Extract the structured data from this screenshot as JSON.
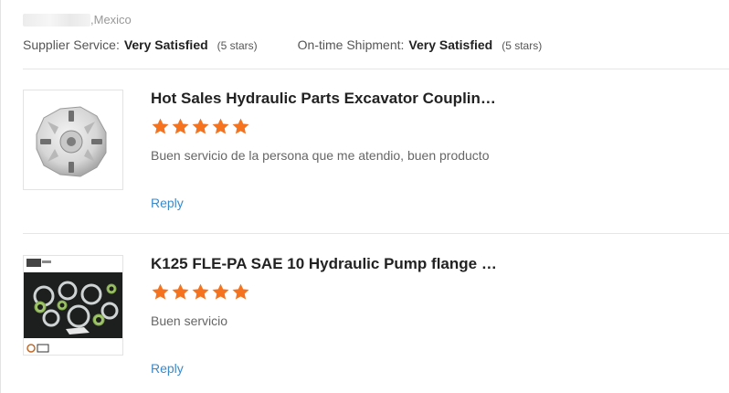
{
  "header": {
    "location": ",Mexico",
    "supplier_label": "Supplier Service:",
    "supplier_value": "Very Satisfied",
    "supplier_stars": "(5 stars)",
    "shipment_label": "On-time Shipment:",
    "shipment_value": "Very Satisfied",
    "shipment_stars": "(5 stars)"
  },
  "reviews": [
    {
      "title": "Hot Sales Hydraulic Parts Excavator Coupling ...",
      "rating": 5,
      "comment": "Buen servicio de la persona que me atendio, buen producto",
      "reply_label": "Reply"
    },
    {
      "title": "K125 FLE-PA SAE 10 Hydraulic Pump flange C...",
      "rating": 5,
      "comment": "Buen servicio",
      "reply_label": "Reply"
    }
  ],
  "colors": {
    "star": "#f5731e",
    "reply": "#3a89c9"
  },
  "icons": {
    "star": "star-icon"
  }
}
